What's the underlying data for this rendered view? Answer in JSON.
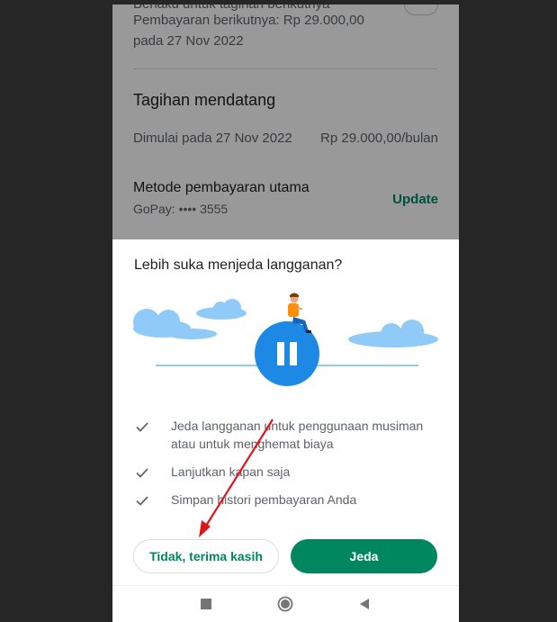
{
  "background_page": {
    "partial_top": "Berlaku untuk tagihan berikutnya",
    "next_payment_line1": "Pembayaran berikutnya: Rp 29.000,00",
    "next_payment_line2": "pada 27 Nov 2022",
    "upcoming_title": "Tagihan mendatang",
    "start_label": "Dimulai pada 27 Nov 2022",
    "price": "Rp 29.000,00/bulan",
    "payment_method_title": "Metode pembayaran utama",
    "payment_method_value": "GoPay: •••• 3555",
    "update_link": "Update"
  },
  "sheet": {
    "title": "Lebih suka menjeda langganan?",
    "features": [
      {
        "text_line1": "Jeda langganan untuk penggunaan musiman",
        "text_line2": "atau untuk menghemat biaya"
      },
      {
        "text_line1": "Lanjutkan kapan saja",
        "text_line2": ""
      },
      {
        "text_line1": "Simpan histori pembayaran Anda",
        "text_line2": ""
      }
    ],
    "decline_button": "Tidak, terima kasih",
    "pause_button": "Jeda"
  },
  "colors": {
    "accent_green": "#01875f",
    "illus_blue": "#1e88e5",
    "cloud_blue": "#90caf9",
    "annotation_red": "#e0141b"
  },
  "icons": {
    "check": "check-icon",
    "pause": "pause-icon",
    "nav_recent": "square-icon",
    "nav_home": "circle-icon",
    "nav_back": "triangle-back-icon"
  }
}
